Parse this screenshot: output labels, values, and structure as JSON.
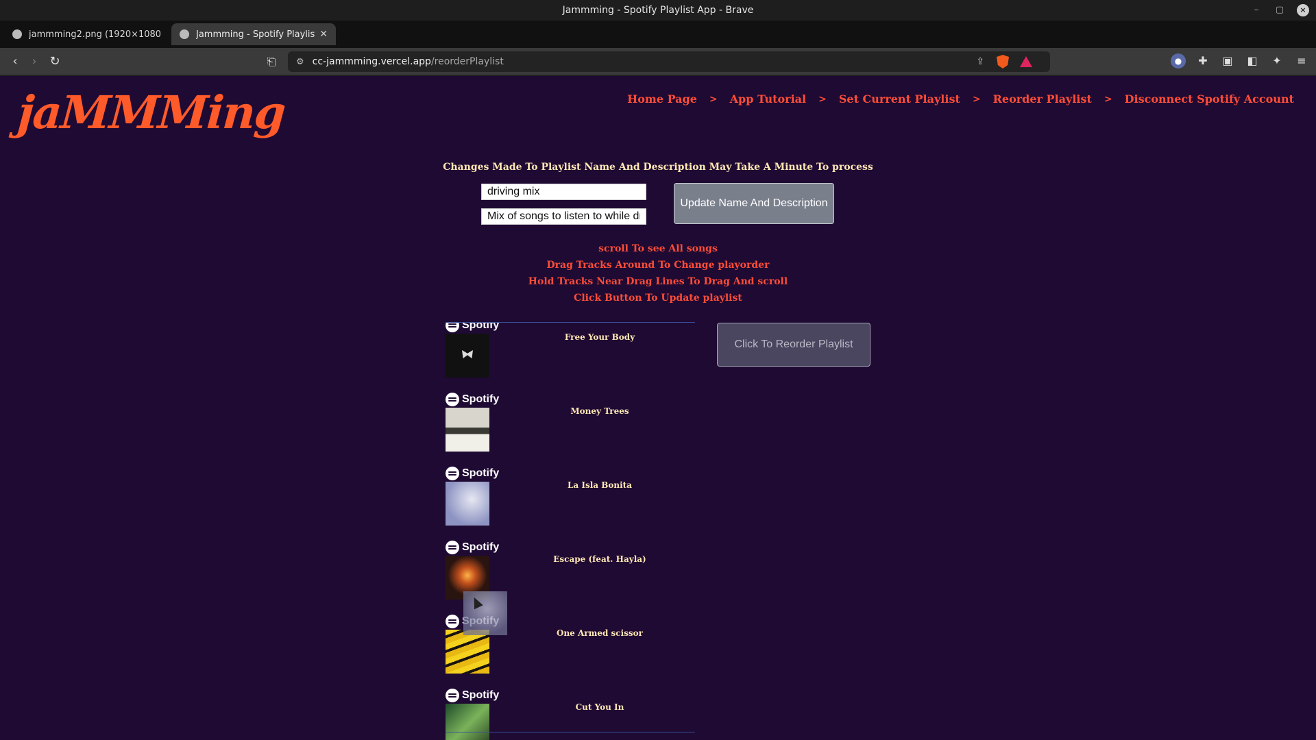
{
  "window": {
    "title": "Jammming - Spotify Playlist App - Brave"
  },
  "tabs": [
    {
      "label": "jammming2.png (1920×1080)"
    },
    {
      "label": "Jammming - Spotify Playlist App"
    }
  ],
  "address": {
    "host": "cc-jammming.vercel.app",
    "path": "/reorderPlaylist"
  },
  "app": {
    "logo": "jaMMMing",
    "nav": {
      "home": "Home Page",
      "tutorial": "App Tutorial",
      "set_current": "Set Current Playlist",
      "reorder": "Reorder Playlist",
      "disconnect": "Disconnect Spotify Account",
      "separator": ">"
    },
    "notice": "Changes Made To Playlist Name And Description May Take A Minute To process",
    "playlist_name": "driving mix",
    "playlist_description": "Mix of songs to listen to while driving",
    "update_button": "Update Name And Description",
    "instructions": [
      "scroll To see All songs",
      "Drag Tracks Around To Change playorder",
      "Hold Tracks Near Drag Lines To Drag And scroll",
      "Click Button To Update playlist"
    ],
    "spotify_label": "Spotify",
    "tracks": [
      {
        "title": "Free Your Body"
      },
      {
        "title": "Money Trees"
      },
      {
        "title": "La Isla Bonita"
      },
      {
        "title": "Escape (feat. Hayla)"
      },
      {
        "title": "One Armed scissor"
      },
      {
        "title": "Cut You In"
      }
    ],
    "reorder_button": "Click To Reorder Playlist"
  }
}
